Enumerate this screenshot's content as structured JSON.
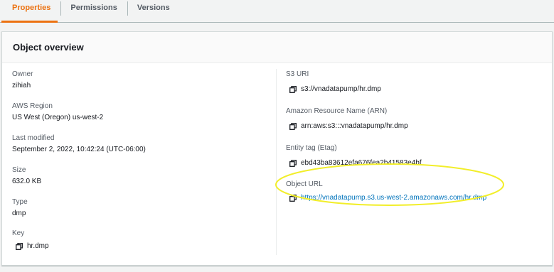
{
  "tabs": [
    {
      "label": "Properties"
    },
    {
      "label": "Permissions"
    },
    {
      "label": "Versions"
    }
  ],
  "overview": {
    "title": "Object overview",
    "left": {
      "owner": {
        "label": "Owner",
        "value": "zihiah"
      },
      "region": {
        "label": "AWS Region",
        "value": "US West (Oregon) us-west-2"
      },
      "modified": {
        "label": "Last modified",
        "value": "September 2, 2022, 10:42:24 (UTC-06:00)"
      },
      "size": {
        "label": "Size",
        "value": "632.0 KB"
      },
      "type": {
        "label": "Type",
        "value": "dmp"
      },
      "key": {
        "label": "Key",
        "value": "hr.dmp"
      }
    },
    "right": {
      "s3uri": {
        "label": "S3 URI",
        "value": "s3://vnadatapump/hr.dmp"
      },
      "arn": {
        "label": "Amazon Resource Name (ARN)",
        "value": "arn:aws:s3:::vnadatapump/hr.dmp"
      },
      "etag": {
        "label": "Entity tag (Etag)",
        "value": "ebd43ba83612efa676fea2b41583e4bf"
      },
      "url": {
        "label": "Object URL",
        "value": "https://vnadatapump.s3.us-west-2.amazonaws.com/hr.dmp"
      }
    }
  },
  "icons": {
    "copy": "copy-icon"
  },
  "colors": {
    "active_tab": "#ec7211",
    "link": "#0073bb",
    "highlight": "#f2ee2a"
  }
}
